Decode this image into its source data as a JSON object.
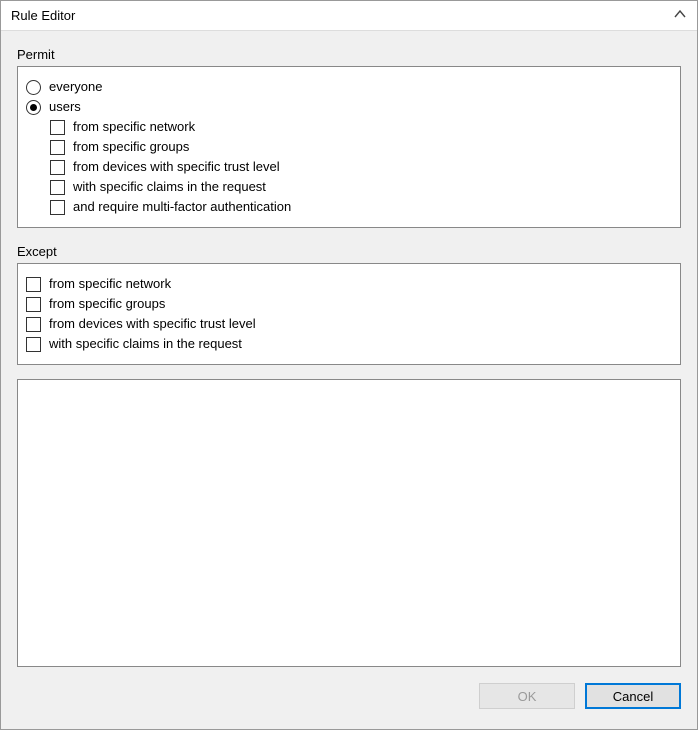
{
  "window": {
    "title": "Rule Editor"
  },
  "permit": {
    "section_label": "Permit",
    "radios": {
      "everyone": {
        "label": "everyone",
        "checked": false
      },
      "users": {
        "label": "users",
        "checked": true
      }
    },
    "user_options": [
      {
        "label": "from specific network",
        "checked": false
      },
      {
        "label": "from specific groups",
        "checked": false
      },
      {
        "label": "from devices with specific trust level",
        "checked": false
      },
      {
        "label": "with specific claims in the request",
        "checked": false
      },
      {
        "label": "and require multi-factor authentication",
        "checked": false
      }
    ]
  },
  "except": {
    "section_label": "Except",
    "options": [
      {
        "label": "from specific network",
        "checked": false
      },
      {
        "label": "from specific groups",
        "checked": false
      },
      {
        "label": "from devices with specific trust level",
        "checked": false
      },
      {
        "label": "with specific claims in the request",
        "checked": false
      }
    ]
  },
  "buttons": {
    "ok": "OK",
    "cancel": "Cancel"
  }
}
